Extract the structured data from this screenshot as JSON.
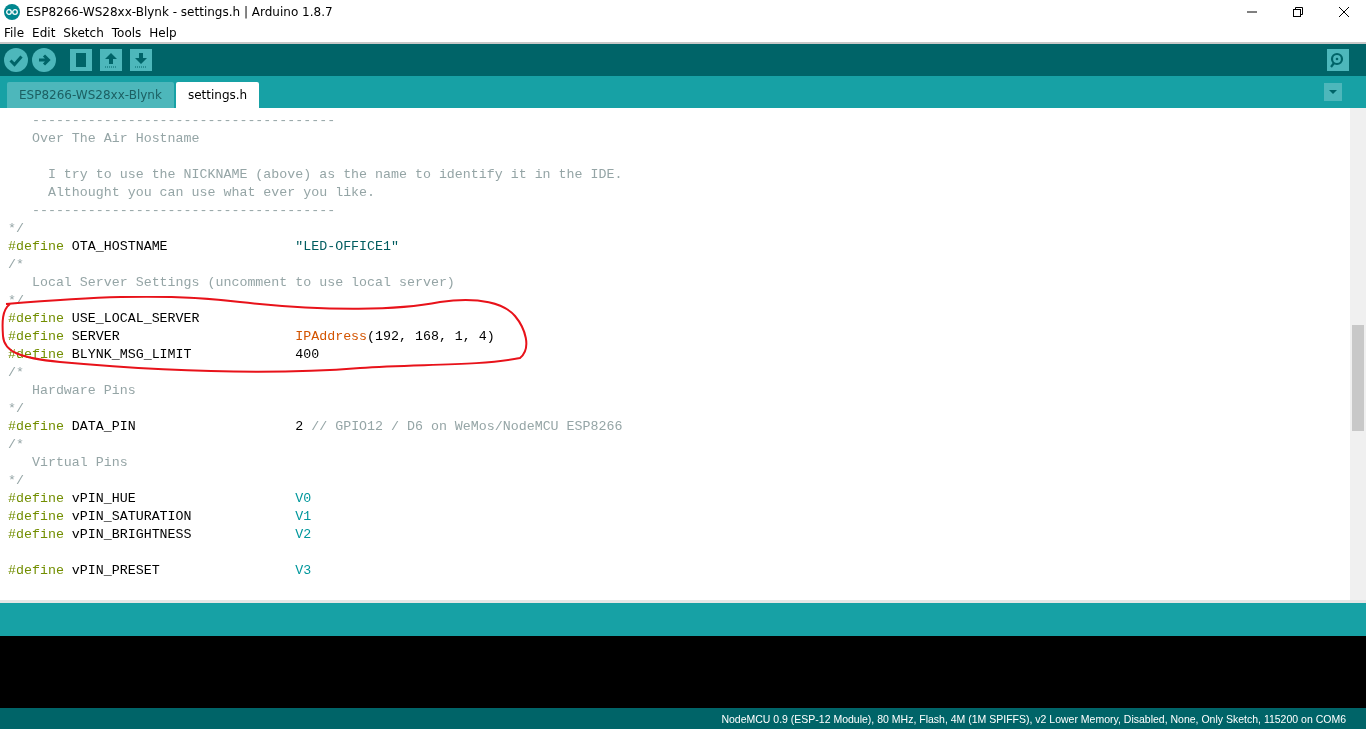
{
  "window": {
    "title": "ESP8266-WS28xx-Blynk - settings.h | Arduino 1.8.7"
  },
  "menu": [
    "File",
    "Edit",
    "Sketch",
    "Tools",
    "Help"
  ],
  "tabs": [
    {
      "label": "ESP8266-WS28xx-Blynk",
      "selected": false
    },
    {
      "label": "settings.h",
      "selected": true
    }
  ],
  "code_lines": [
    [
      {
        "kind": "comment",
        "text": "   --------------------------------------"
      }
    ],
    [
      {
        "kind": "comment",
        "text": "   Over The Air Hostname"
      }
    ],
    [
      {
        "kind": "blank"
      }
    ],
    [
      {
        "kind": "comment",
        "text": "     I try to use the NICKNAME (above) as the name to identify it in the IDE."
      }
    ],
    [
      {
        "kind": "comment",
        "text": "     Althought you can use what ever you like."
      }
    ],
    [
      {
        "kind": "comment",
        "text": "   --------------------------------------"
      }
    ],
    [
      {
        "kind": "comment",
        "text": "*/"
      }
    ],
    [
      {
        "kind": "keyword",
        "text": "#define"
      },
      {
        "kind": "plain",
        "text": " OTA_HOSTNAME                "
      },
      {
        "kind": "string",
        "text": "\"LED-OFFICE1\""
      }
    ],
    [
      {
        "kind": "comment",
        "text": "/*"
      }
    ],
    [
      {
        "kind": "comment",
        "text": "   Local Server Settings (uncomment to use local server)"
      }
    ],
    [
      {
        "kind": "comment",
        "text": "*/"
      }
    ],
    [
      {
        "kind": "keyword",
        "text": "#define"
      },
      {
        "kind": "plain",
        "text": " USE_LOCAL_SERVER"
      }
    ],
    [
      {
        "kind": "keyword",
        "text": "#define"
      },
      {
        "kind": "plain",
        "text": " SERVER                      "
      },
      {
        "kind": "function",
        "text": "IPAddress"
      },
      {
        "kind": "plain",
        "text": "(192, 168, 1, 4)"
      }
    ],
    [
      {
        "kind": "keyword",
        "text": "#define"
      },
      {
        "kind": "plain",
        "text": " BLYNK_MSG_LIMIT             400"
      }
    ],
    [
      {
        "kind": "comment",
        "text": "/*"
      }
    ],
    [
      {
        "kind": "comment",
        "text": "   Hardware Pins"
      }
    ],
    [
      {
        "kind": "comment",
        "text": "*/"
      }
    ],
    [
      {
        "kind": "keyword",
        "text": "#define"
      },
      {
        "kind": "plain",
        "text": " DATA_PIN                    2 "
      },
      {
        "kind": "comment",
        "text": "// GPIO12 / D6 on WeMos/NodeMCU ESP8266"
      }
    ],
    [
      {
        "kind": "comment",
        "text": "/*"
      }
    ],
    [
      {
        "kind": "comment",
        "text": "   Virtual Pins"
      }
    ],
    [
      {
        "kind": "comment",
        "text": "*/"
      }
    ],
    [
      {
        "kind": "keyword",
        "text": "#define"
      },
      {
        "kind": "plain",
        "text": " vPIN_HUE                    "
      },
      {
        "kind": "constant",
        "text": "V0"
      }
    ],
    [
      {
        "kind": "keyword",
        "text": "#define"
      },
      {
        "kind": "plain",
        "text": " vPIN_SATURATION             "
      },
      {
        "kind": "constant",
        "text": "V1"
      }
    ],
    [
      {
        "kind": "keyword",
        "text": "#define"
      },
      {
        "kind": "plain",
        "text": " vPIN_BRIGHTNESS             "
      },
      {
        "kind": "constant",
        "text": "V2"
      }
    ],
    [
      {
        "kind": "blank"
      }
    ],
    [
      {
        "kind": "keyword",
        "text": "#define"
      },
      {
        "kind": "plain",
        "text": " vPIN_PRESET                 "
      },
      {
        "kind": "constant",
        "text": "V3"
      }
    ]
  ],
  "status_bar": "NodeMCU 0.9 (ESP-12 Module), 80 MHz, Flash, 4M (1M SPIFFS), v2 Lower Memory, Disabled, None, Only Sketch, 115200 on COM6"
}
